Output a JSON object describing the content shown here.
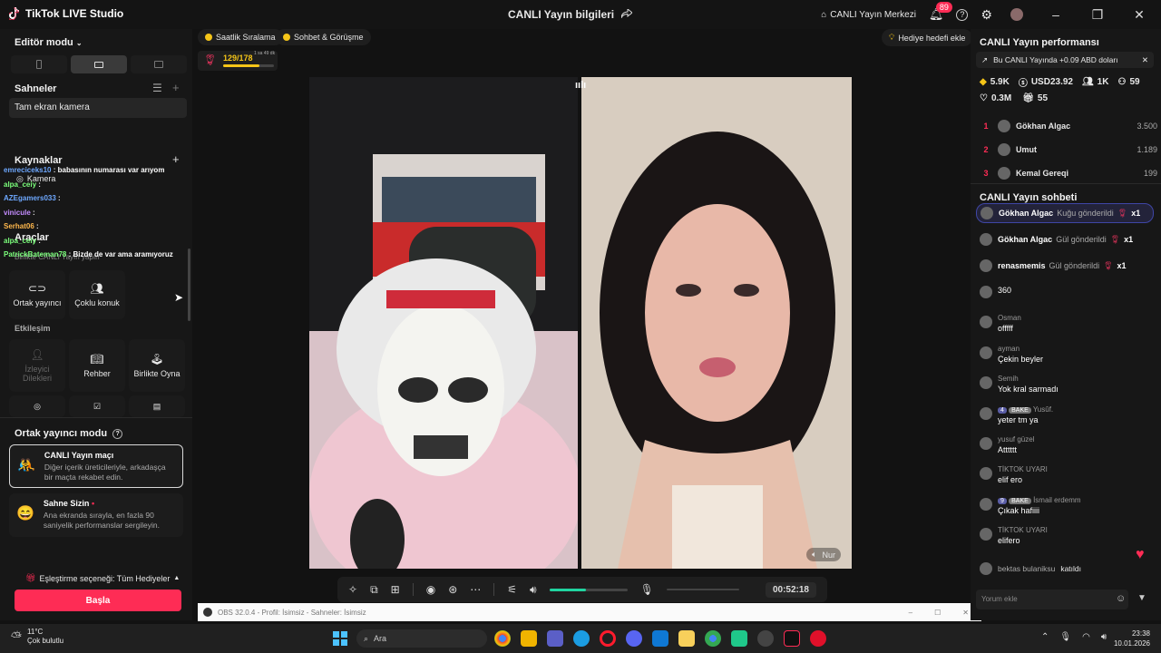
{
  "titlebar": {
    "app_name": "TikTok LIVE Studio",
    "center_title": "CANLI Yayın bilgileri",
    "live_center": "CANLI Yayın Merkezi",
    "notif_count": "89"
  },
  "left": {
    "editor_mode": "Editör modu",
    "scenes_title": "Sahneler",
    "scene_item": "Tam ekran kamera",
    "sources_title": "Kaynaklar",
    "source_camera": "Kamera",
    "tools_title": "Araçlar",
    "tools_sub": "Birlikte CANLI Yayın yapın",
    "tools": [
      "Ortak yayıncı",
      "Çoklu konuk"
    ],
    "interaction_title": "Etkileşim",
    "interaction": [
      "İzleyici Dilekleri",
      "Rehber",
      "Birlikte Oyna"
    ],
    "cohost_mode": "Ortak yayıncı modu",
    "match_title": "CANLI Yayın maçı",
    "match_desc": "Diğer içerik üreticileriyle, arkadaşça bir maçta rekabet edin.",
    "stage_title": "Sahne Sizin",
    "stage_desc": "Ana ekranda sırayla, en fazla 90 saniyelik performanslar sergileyin.",
    "match_option": "Eşleştirme seçeneği: Tüm Hediyeler",
    "start": "Başla",
    "chat_overlay": [
      {
        "user": "emreciceks10",
        "text": "babasının numarası var arıyom",
        "color": "#6ea8ff"
      },
      {
        "user": "alpa_ceiy",
        "text": "",
        "color": "#7cff7c"
      },
      {
        "user": "AZEgamers033",
        "text": "",
        "color": "#6ea8ff"
      },
      {
        "user": "vinicule",
        "text": "",
        "color": "#c48cff"
      },
      {
        "user": "Serhat06",
        "text": "",
        "color": "#ffb84c"
      },
      {
        "user": "alpa_ceiy",
        "text": "",
        "color": "#7cff7c"
      },
      {
        "user": "PatrickBateman78",
        "text": "Bizde de var ama aramıyoruz",
        "color": "#7cff7c"
      }
    ]
  },
  "center": {
    "pill1": "Saatlik Sıralama",
    "pill2": "Sohbet & Görüşme",
    "gift_goal": "Hediye hedefi ekle",
    "progress_text": "129/178",
    "progress": 0.72,
    "timer_small": "1 sa 49 dk",
    "cohost_name": "Nur",
    "elapsed": "00:52:18",
    "obs_title": "OBS 32.0.4 - Profil: İsimsiz - Sahneler: İsimsiz"
  },
  "right": {
    "perf_title": "CANLI Yayın performansı",
    "earn_banner": "Bu CANLI Yayında +0.09 ABD doları",
    "stats1": [
      "5.9K",
      "USD23.92",
      "1K",
      "59"
    ],
    "stats2": [
      "0.3M",
      "55"
    ],
    "ranking": [
      {
        "rank": "1",
        "name": "Gökhan Algac",
        "value": "3.500"
      },
      {
        "rank": "2",
        "name": "Umut",
        "value": "1.189"
      },
      {
        "rank": "3",
        "name": "Kemal Gereqi",
        "value": "199"
      }
    ],
    "chat_title": "CANLI Yayın sohbeti",
    "gifts": [
      {
        "user": "Gökhan Algac",
        "action": "Kuğu gönderildi",
        "count": "x1"
      },
      {
        "user": "Gökhan Algac",
        "action": "Gül gönderildi",
        "count": "x1"
      },
      {
        "user": "renasmemis",
        "action": "Gül gönderildi",
        "count": "x1"
      }
    ],
    "messages": [
      {
        "user": "",
        "text": "360"
      },
      {
        "user": "Osman",
        "text": "offfff"
      },
      {
        "user": "ayman",
        "text": "Çekin beyler"
      },
      {
        "user": "Semih",
        "text": "Yok kral sarmadı"
      },
      {
        "user": "Yusûf.",
        "text": "yeter tm ya",
        "lvl": "4",
        "tag": "BAKE"
      },
      {
        "user": "yusuf güzel",
        "text": "Atttttt"
      },
      {
        "user": "TİKTOK UYARI",
        "text": "elif ero"
      },
      {
        "user": "İsmail erdemm",
        "text": "Çıkak hafiiii",
        "lvl": "9",
        "tag": "BAKE"
      },
      {
        "user": "TİKTOK UYARI",
        "text": "elifero"
      }
    ],
    "join_user": "bektas bulaniksu",
    "join_text": "katıldı",
    "comment_placeholder": "Yorum ekle"
  },
  "taskbar": {
    "temp": "11°C",
    "weather": "Çok bulutlu",
    "search": "Ara",
    "time": "23:38",
    "date": "10.01.2026"
  }
}
